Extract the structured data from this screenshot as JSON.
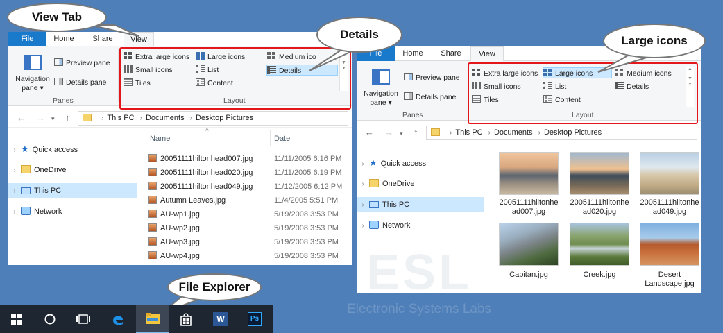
{
  "callouts": {
    "view_tab": "View Tab",
    "details": "Details",
    "large_icons": "Large icons",
    "file_explorer": "File Explorer"
  },
  "ribbon": {
    "tabs": [
      "File",
      "Home",
      "Share",
      "View"
    ],
    "panes": {
      "navigation_pane": "Navigation",
      "navigation_pane_2": "pane",
      "preview_pane": "Preview pane",
      "details_pane": "Details pane",
      "group_label": "Panes"
    },
    "layout": {
      "extra_large_icons": "Extra large icons",
      "large_icons": "Large icons",
      "medium_icons": "Medium icons",
      "medium_icons_short": "Medium ico",
      "small_icons": "Small icons",
      "list": "List",
      "details": "Details",
      "tiles": "Tiles",
      "content": "Content",
      "group_label": "Layout"
    }
  },
  "address": {
    "crumbs": [
      "This PC",
      "Documents",
      "Desktop Pictures"
    ]
  },
  "nav_tree": [
    {
      "label": "Quick access",
      "icon": "star-icon"
    },
    {
      "label": "OneDrive",
      "icon": "folder-icon"
    },
    {
      "label": "This PC",
      "icon": "computer-icon"
    },
    {
      "label": "Network",
      "icon": "network-icon"
    }
  ],
  "details_view": {
    "col_name": "Name",
    "col_date": "Date",
    "sort_indicator": "^",
    "rows": [
      {
        "name": "20051111hiltonhead007.jpg",
        "date": "11/11/2005 6:16 PM"
      },
      {
        "name": "20051111hiltonhead020.jpg",
        "date": "11/11/2005 6:19 PM"
      },
      {
        "name": "20051111hiltonhead049.jpg",
        "date": "11/12/2005 6:12 PM"
      },
      {
        "name": "Autumn Leaves.jpg",
        "date": "11/4/2005 5:51 PM"
      },
      {
        "name": "AU-wp1.jpg",
        "date": "5/19/2008 3:53 PM"
      },
      {
        "name": "AU-wp2.jpg",
        "date": "5/19/2008 3:53 PM"
      },
      {
        "name": "AU-wp3.jpg",
        "date": "5/19/2008 3:53 PM"
      },
      {
        "name": "AU-wp4.jpg",
        "date": "5/19/2008 3:53 PM"
      }
    ]
  },
  "large_icons_view": {
    "items": [
      {
        "name_line1": "20051111hiltonhe",
        "name_line2": "ad007.jpg"
      },
      {
        "name_line1": "20051111hiltonhe",
        "name_line2": "ad020.jpg"
      },
      {
        "name_line1": "20051111hiltonhe",
        "name_line2": "ad049.jpg"
      },
      {
        "name_line1": "Capitan.jpg",
        "name_line2": ""
      },
      {
        "name_line1": "Creek.jpg",
        "name_line2": ""
      },
      {
        "name_line1": "Desert",
        "name_line2": "Landscape.jpg"
      }
    ]
  },
  "watermark": {
    "logo": "ESL",
    "company": "Electronic Systems Labs"
  },
  "taskbar": {
    "items": [
      "start-icon",
      "cortana-icon",
      "task-view-icon",
      "edge-icon",
      "file-explorer-icon",
      "store-icon",
      "word-icon",
      "photoshop-icon"
    ],
    "ps_label": "Ps",
    "word_label": "W"
  },
  "colors": {
    "desktop": "#4f7fb9",
    "highlight": "#e3161b",
    "file_tab": "#1979ca",
    "selection": "#cce8ff"
  }
}
